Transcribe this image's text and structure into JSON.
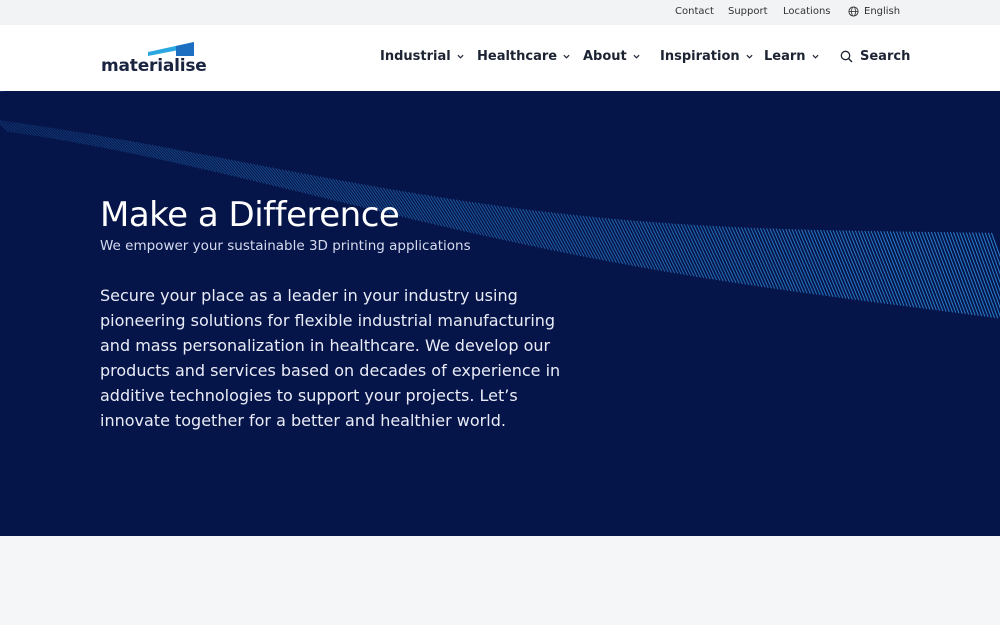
{
  "utility": {
    "contact": "Contact",
    "support": "Support",
    "locations": "Locations",
    "language": "English",
    "language_icon": "globe-icon"
  },
  "brand": {
    "name": "materialise",
    "accent": "#2aa6e0",
    "accent_dark": "#1d6fc2"
  },
  "nav": {
    "industrial": "Industrial",
    "healthcare": "Healthcare",
    "about": "About",
    "inspiration": "Inspiration",
    "learn": "Learn",
    "search": "Search"
  },
  "hero": {
    "title": "Make a Difference",
    "subtitle": "We empower your sustainable 3D printing applications",
    "body": "Secure your place as a leader in your industry using pioneering solutions for flexible industrial manufacturing and mass personalization in healthcare. We develop our products and services based on decades of experience in additive technologies to support your projects. Let’s innovate together for a better and healthier world.",
    "background": "#061549",
    "wave_color": "#2f8fe0"
  }
}
